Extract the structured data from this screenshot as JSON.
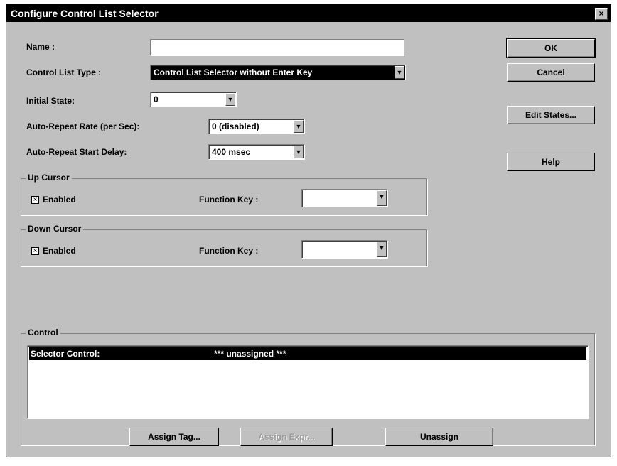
{
  "window": {
    "title": "Configure Control List Selector",
    "close_glyph": "×"
  },
  "form": {
    "name_label": "Name :",
    "name_value": "",
    "list_type_label": "Control List Type :",
    "list_type_value": "Control List Selector without Enter Key",
    "initial_state_label": "Initial State:",
    "initial_state_value": "0",
    "repeat_rate_label": "Auto-Repeat Rate (per Sec):",
    "repeat_rate_value": "0 (disabled)",
    "repeat_delay_label": "Auto-Repeat Start Delay:",
    "repeat_delay_value": "400 msec"
  },
  "up_cursor": {
    "legend": "Up Cursor",
    "enabled_label": "Enabled",
    "enabled": true,
    "function_key_label": "Function Key :",
    "function_key_value": ""
  },
  "down_cursor": {
    "legend": "Down Cursor",
    "enabled_label": "Enabled",
    "enabled": true,
    "function_key_label": "Function Key :",
    "function_key_value": ""
  },
  "buttons": {
    "ok": "OK",
    "cancel": "Cancel",
    "edit_states": "Edit States...",
    "help": "Help",
    "assign_tag": "Assign Tag...",
    "assign_expr": "Assign Expr...",
    "unassign": "Unassign"
  },
  "control": {
    "legend": "Control",
    "rows": [
      {
        "name": "Selector Control:",
        "value": "*** unassigned ***"
      }
    ]
  },
  "icons": {
    "dropdown_arrow": "chevron-down-icon",
    "check_mark": "×"
  }
}
